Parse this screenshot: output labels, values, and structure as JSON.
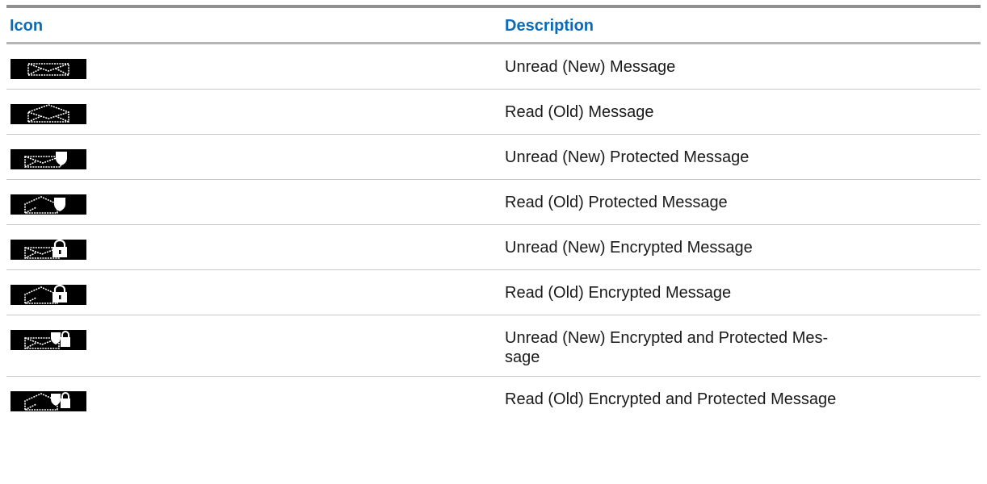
{
  "table": {
    "header": {
      "icon": "Icon",
      "description": "Description"
    },
    "rows": [
      {
        "icon": "unread-message-icon",
        "description": "Unread (New) Message"
      },
      {
        "icon": "read-message-icon",
        "description": "Read (Old) Message"
      },
      {
        "icon": "unread-protected-message-icon",
        "description": "Unread (New) Protected Message"
      },
      {
        "icon": "read-protected-message-icon",
        "description": "Read (Old) Protected Message"
      },
      {
        "icon": "unread-encrypted-message-icon",
        "description": "Unread (New) Encrypted Message"
      },
      {
        "icon": "read-encrypted-message-icon",
        "description": "Read (Old) Encrypted Message"
      },
      {
        "icon": "unread-encrypted-protected-message-icon",
        "description": "Unread (New) Encrypted and Protected Mes-\nsage"
      },
      {
        "icon": "read-encrypted-protected-message-icon",
        "description": "Read (Old) Encrypted and Protected Message"
      }
    ]
  }
}
